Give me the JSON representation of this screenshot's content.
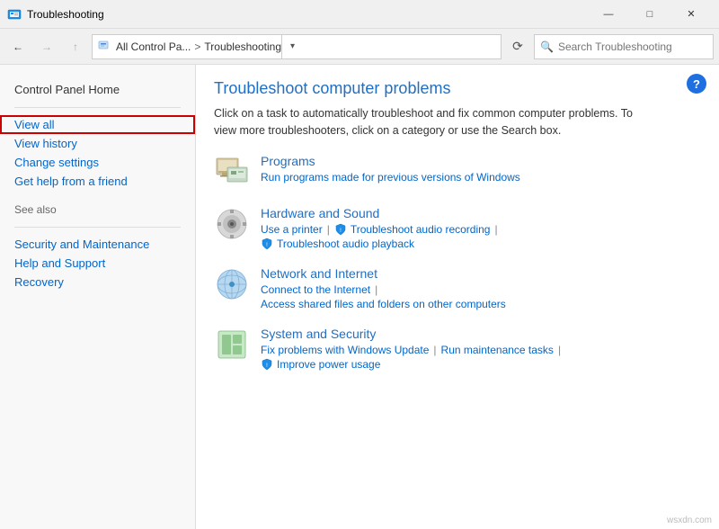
{
  "titlebar": {
    "icon": "🛠",
    "title": "Troubleshooting",
    "min_btn": "—",
    "max_btn": "□",
    "close_btn": "✕"
  },
  "addressbar": {
    "back_btn": "←",
    "forward_btn": "→",
    "up_btn": "↑",
    "location_icon": "🗂",
    "breadcrumb_parent": "All Control Pa...",
    "breadcrumb_sep": ">",
    "breadcrumb_current": "Troubleshooting",
    "dropdown_arrow": "▾",
    "refresh_btn": "⟳",
    "search_placeholder": "Search Troubleshooting"
  },
  "sidebar": {
    "home_label": "Control Panel Home",
    "view_all_label": "View all",
    "view_history_label": "View history",
    "change_settings_label": "Change settings",
    "get_help_label": "Get help from a friend",
    "see_also_label": "See also",
    "security_label": "Security and Maintenance",
    "help_support_label": "Help and Support",
    "recovery_label": "Recovery"
  },
  "content": {
    "title": "Troubleshoot computer problems",
    "description": "Click on a task to automatically troubleshoot and fix common computer problems. To view more troubleshooters, click on a category or use the Search box.",
    "help_btn": "?",
    "categories": [
      {
        "name": "Programs",
        "description": "Run programs made for previous versions of Windows",
        "links": [],
        "icon_type": "programs"
      },
      {
        "name": "Hardware and Sound",
        "description": "",
        "links": [
          {
            "label": "Use a printer",
            "has_shield": false
          },
          {
            "label": "Troubleshoot audio recording",
            "has_shield": true
          },
          {
            "label": "Troubleshoot audio playback",
            "has_shield": true
          }
        ],
        "icon_type": "hardware"
      },
      {
        "name": "Network and Internet",
        "description": "",
        "links": [
          {
            "label": "Connect to the Internet",
            "has_shield": false
          },
          {
            "label": "Access shared files and folders on other computers",
            "has_shield": false
          }
        ],
        "icon_type": "network"
      },
      {
        "name": "System and Security",
        "description": "",
        "links": [
          {
            "label": "Fix problems with Windows Update",
            "has_shield": false
          },
          {
            "label": "Run maintenance tasks",
            "has_shield": false
          },
          {
            "label": "Improve power usage",
            "has_shield": true
          }
        ],
        "icon_type": "system"
      }
    ]
  },
  "watermark": "wsxdn.com"
}
